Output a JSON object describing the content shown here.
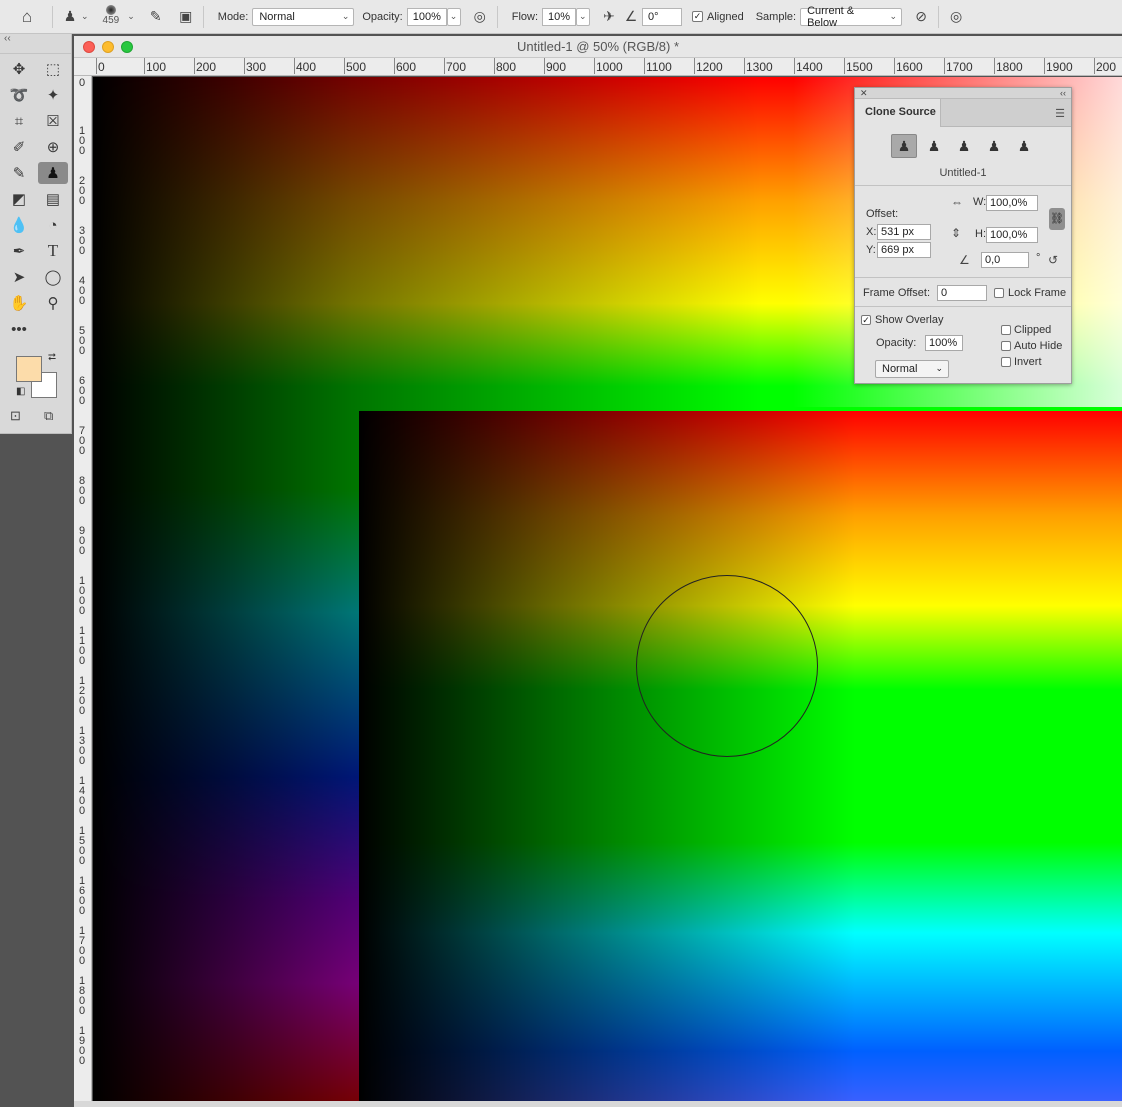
{
  "options_bar": {
    "brush_size": "459",
    "mode_label": "Mode:",
    "mode_value": "Normal",
    "opacity_label": "Opacity:",
    "opacity_value": "100%",
    "flow_label": "Flow:",
    "flow_value": "10%",
    "angle_value": "0°",
    "aligned_label": "Aligned",
    "aligned_checked": true,
    "sample_label": "Sample:",
    "sample_value": "Current & Below"
  },
  "toolbar": {
    "tools": [
      "move-tool",
      "marquee-tool",
      "lasso-tool",
      "magic-wand-tool",
      "crop-tool",
      "frame-tool",
      "eyedropper-tool",
      "healing-brush-tool",
      "brush-tool",
      "clone-stamp-tool",
      "eraser-tool",
      "gradient-tool",
      "blur-tool",
      "dodge-tool",
      "pen-tool",
      "type-tool",
      "path-selection-tool",
      "ellipse-tool",
      "hand-tool",
      "zoom-tool",
      "more-tools"
    ],
    "active_tool": "clone-stamp-tool",
    "foreground_color": "#fcdcaa",
    "background_color": "#ffffff"
  },
  "document": {
    "title": "Untitled-1 @ 50% (RGB/8) *",
    "h_ruler_ticks": [
      "0",
      "100",
      "200",
      "300",
      "400",
      "500",
      "600",
      "700",
      "800",
      "900",
      "1000",
      "1100",
      "1200",
      "1300",
      "1400",
      "1500",
      "1600",
      "1700",
      "1800",
      "1900",
      "200"
    ],
    "v_ruler_ticks": [
      "0",
      "100",
      "200",
      "300",
      "400",
      "500",
      "600",
      "700",
      "800",
      "900",
      "1000",
      "1100",
      "1200",
      "1300",
      "1400",
      "1500",
      "1600",
      "1700",
      "1800",
      "1900"
    ]
  },
  "clone_source_panel": {
    "title": "Clone Source",
    "source_name": "Untitled-1",
    "offset_label": "Offset:",
    "x_label": "X:",
    "x_value": "531 px",
    "y_label": "Y:",
    "y_value": "669 px",
    "w_label": "W:",
    "w_value": "100,0%",
    "h_label": "H:",
    "h_value": "100,0%",
    "angle_value": "0,0",
    "degree_symbol": "°",
    "frame_offset_label": "Frame Offset:",
    "frame_offset_value": "0",
    "lock_frame_label": "Lock Frame",
    "show_overlay_label": "Show Overlay",
    "show_overlay_checked": true,
    "overlay_opacity_label": "Opacity:",
    "overlay_opacity_value": "100%",
    "blend_mode_value": "Normal",
    "clipped_label": "Clipped",
    "auto_hide_label": "Auto Hide",
    "invert_label": "Invert"
  }
}
